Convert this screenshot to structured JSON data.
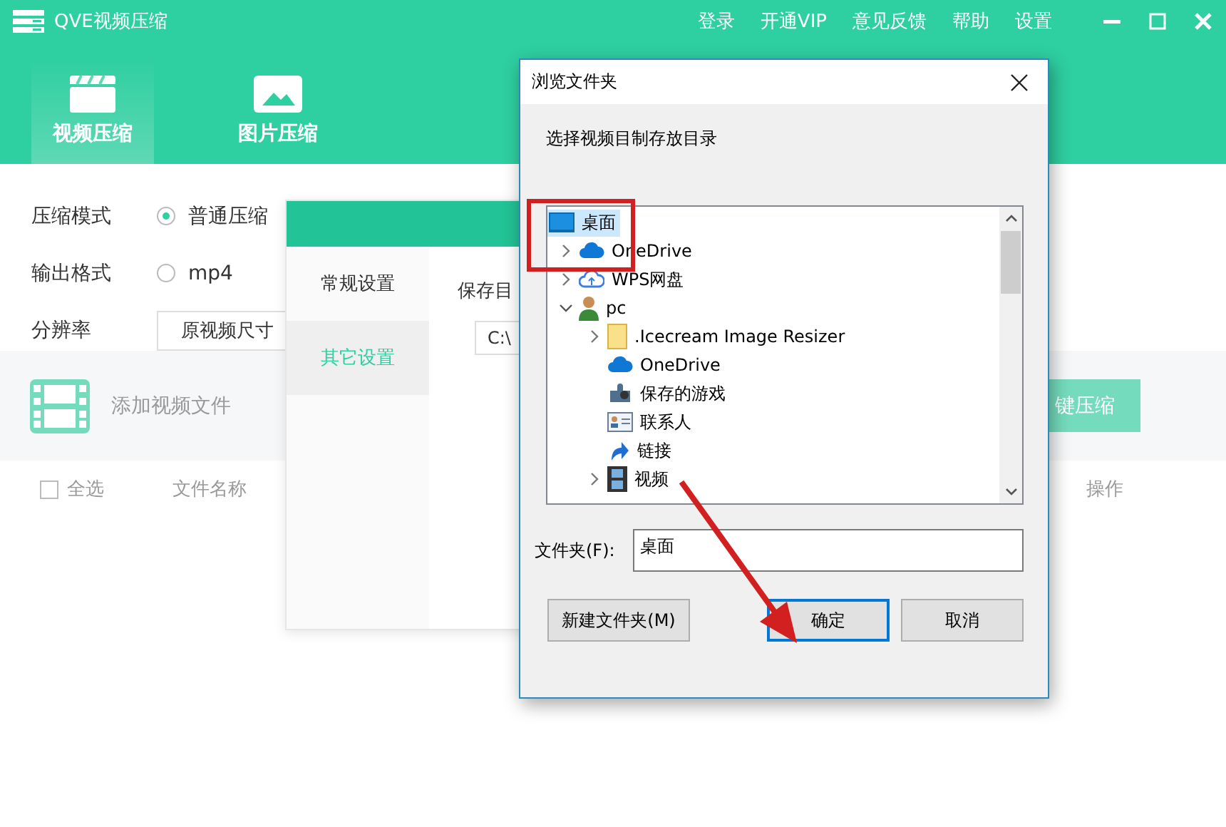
{
  "app": {
    "title": "QVE视频压缩",
    "menu": [
      "登录",
      "开通VIP",
      "意见反馈",
      "帮助",
      "设置"
    ],
    "tabs": [
      {
        "label": "视频压缩",
        "kind": "video",
        "selected": true
      },
      {
        "label": "图片压缩",
        "kind": "image",
        "selected": false
      }
    ],
    "options": [
      {
        "kind": "radio",
        "label": "压缩模式",
        "value": "普通压缩",
        "selected": true
      },
      {
        "kind": "radio",
        "label": "输出格式",
        "value": "mp4",
        "selected": false
      },
      {
        "kind": "select",
        "label": "分辨率",
        "value": "原视频尺寸"
      }
    ],
    "add_files": "添加视频文件",
    "compress_button": "键压缩",
    "columns": [
      {
        "kind": "checkbox",
        "label": "全选",
        "checked": false
      },
      {
        "kind": "text",
        "label": "文件名称"
      },
      {
        "kind": "text",
        "label": "操作"
      }
    ]
  },
  "settings_dialog": {
    "nav": [
      {
        "label": "常规设置",
        "selected": false
      },
      {
        "label": "其它设置",
        "selected": true
      }
    ],
    "save_dir_label": "保存目",
    "save_dir_value": "C:\\"
  },
  "browse_dialog": {
    "title": "浏览文件夹",
    "instruction": "选择视频目制存放目录",
    "tree": [
      {
        "label": "桌面",
        "kind": "desktop",
        "expandable": false,
        "selected": true,
        "children": [
          {
            "label": "OneDrive",
            "kind": "cloud",
            "expandable": true,
            "expanded": false,
            "selected": false
          },
          {
            "label": "WPS网盘",
            "kind": "netdisk",
            "expandable": true,
            "expanded": false,
            "selected": false
          },
          {
            "label": "pc",
            "kind": "user",
            "expandable": true,
            "expanded": true,
            "selected": false,
            "children": [
              {
                "label": ".Icecream Image Resizer",
                "kind": "folder",
                "expandable": true,
                "expanded": false,
                "selected": false
              },
              {
                "label": "OneDrive",
                "kind": "cloud",
                "expandable": false,
                "selected": false
              },
              {
                "label": "保存的游戏",
                "kind": "games",
                "expandable": false,
                "selected": false
              },
              {
                "label": "联系人",
                "kind": "contacts",
                "expandable": false,
                "selected": false
              },
              {
                "label": "链接",
                "kind": "links",
                "expandable": false,
                "selected": false
              },
              {
                "label": "视频",
                "kind": "videos",
                "expandable": true,
                "expanded": false,
                "selected": false
              }
            ]
          }
        ]
      }
    ],
    "folder_label": "文件夹(F):",
    "folder_value": "桌面",
    "buttons": [
      {
        "label": "新建文件夹(M)",
        "default": false
      },
      {
        "label": "确定",
        "default": true
      },
      {
        "label": "取消",
        "default": false
      }
    ]
  }
}
